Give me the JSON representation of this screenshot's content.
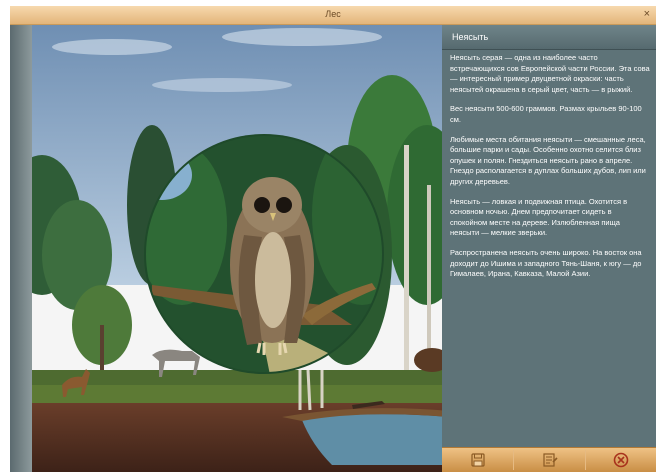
{
  "window": {
    "title": "Лес",
    "close_glyph": "×"
  },
  "panel": {
    "title": "Неясыть",
    "paragraphs": [
      "Неясыть серая — одна из наиболее часто встречающихся сов Европейской части России. Эта сова — интересный пример двуцветной окраски: часть неясытей окрашена в серый цвет, часть — в рыжий.",
      "Вес неясыти 500-600 граммов. Размах крыльев 90-100 см.",
      "Любимые места обитания неясыти — смешанные леса, большие парки и сады. Особенно охотно селится близ опушек и полян. Гнездиться неясыть рано в апреле. Гнездо располагается в дуплах больших дубов, лип или других деревьев.",
      "Неясыть — ловкая и подвижная птица. Охотится в основном ночью. Днем предпочитает сидеть в спокойном месте на дереве. Излюбленная пища неясыти — мелкие зверьки.",
      "Распространена неясыть очень широко. На восток она доходит до Ишима и западного Тянь-Шаня, к югу — до Гималаев, Ирана, Кавказа, Малой Азии."
    ]
  },
  "toolbar": {
    "buttons": [
      {
        "icon": "save-icon"
      },
      {
        "icon": "notes-icon"
      },
      {
        "icon": "close-circle-icon"
      }
    ]
  },
  "colors": {
    "titlebar": "#e9c08a",
    "panel": "#5e7378",
    "toolbar": "#dca563",
    "accent_close": "#c0392b"
  }
}
